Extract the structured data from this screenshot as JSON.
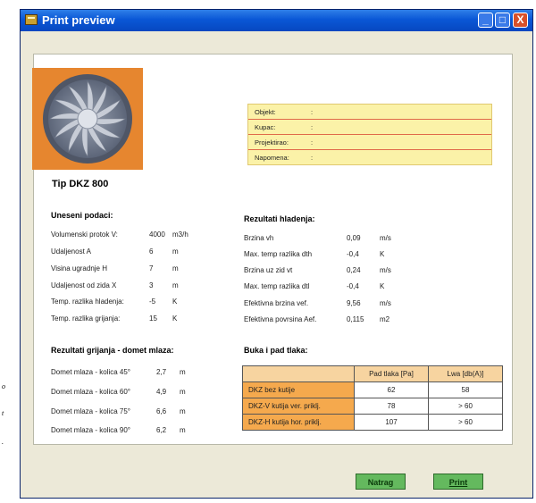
{
  "window": {
    "title": "Print preview",
    "min_symbol": "_",
    "max_symbol": "□",
    "close_symbol": "X"
  },
  "product": {
    "type_label": "Tip DKZ 800"
  },
  "project_info": {
    "rows": [
      {
        "label": "Objekt:",
        "colon": ":"
      },
      {
        "label": "Kupac:",
        "colon": ":"
      },
      {
        "label": "Projektirao:",
        "colon": ":"
      },
      {
        "label": "Napomena:",
        "colon": ":"
      }
    ]
  },
  "input_data": {
    "title": "Uneseni podaci:",
    "rows": [
      {
        "label": "Volumenski protok V:",
        "value": "4000",
        "unit": "m3/h"
      },
      {
        "label": "Udaljenost A",
        "value": "6",
        "unit": "m"
      },
      {
        "label": "Visina ugradnje H",
        "value": "7",
        "unit": "m"
      },
      {
        "label": "Udaljenost od zida X",
        "value": "3",
        "unit": "m"
      },
      {
        "label": "Temp. razlika hladenja:",
        "value": "-5",
        "unit": "K"
      },
      {
        "label": "Temp. razlika grijanja:",
        "value": "15",
        "unit": "K"
      }
    ]
  },
  "cooling_results": {
    "title": "Rezultati hladenja:",
    "rows": [
      {
        "label": "Brzina vh",
        "value": "0,09",
        "unit": "m/s"
      },
      {
        "label": "Max. temp razlika dth",
        "value": "-0,4",
        "unit": "K"
      },
      {
        "label": "Brzina uz zid vt",
        "value": "0,24",
        "unit": "m/s"
      },
      {
        "label": "Max. temp razlika dtl",
        "value": "-0,4",
        "unit": "K"
      },
      {
        "label": "Efektivna brzina vef.",
        "value": "9,56",
        "unit": "m/s"
      },
      {
        "label": "Efektivna povrsina Aef.",
        "value": "0,115",
        "unit": "m2"
      }
    ]
  },
  "heating_results": {
    "title": "Rezultati grijanja - domet mlaza:",
    "rows": [
      {
        "label": "Domet mlaza - kolica 45°",
        "value": "2,7",
        "unit": "m"
      },
      {
        "label": "Domet mlaza - kolica 60°",
        "value": "4,9",
        "unit": "m"
      },
      {
        "label": "Domet mlaza - kolica 75°",
        "value": "6,6",
        "unit": "m"
      },
      {
        "label": "Domet mlaza - kolica 90°",
        "value": "6,2",
        "unit": "m"
      }
    ]
  },
  "noise": {
    "title": "Buka i pad tlaka:",
    "headers": [
      "Pad tlaka [Pa]",
      "Lwa [db(A)]"
    ],
    "rows": [
      {
        "name": "DKZ    bez kutije",
        "pressure": "62",
        "lwa": "58"
      },
      {
        "name": "DKZ-V  kutija ver. priklj.",
        "pressure": "78",
        "lwa": "> 60"
      },
      {
        "name": "DKZ-H  kutija hor. priklj.",
        "pressure": "107",
        "lwa": "> 60"
      }
    ]
  },
  "buttons": {
    "back": "Natrag",
    "print": "Print"
  },
  "external_fragments": [
    "o",
    "t",
    "."
  ],
  "colors": {
    "titlebar": "#0a57d6",
    "info_bg": "#fbf2a8",
    "table_header": "#f7d4a0",
    "table_label": "#f5a94d",
    "buttons": "#64b95e",
    "fan_bg": "#e6862f"
  },
  "icons": {
    "app": "printer-icon",
    "fan": "fan-image"
  }
}
